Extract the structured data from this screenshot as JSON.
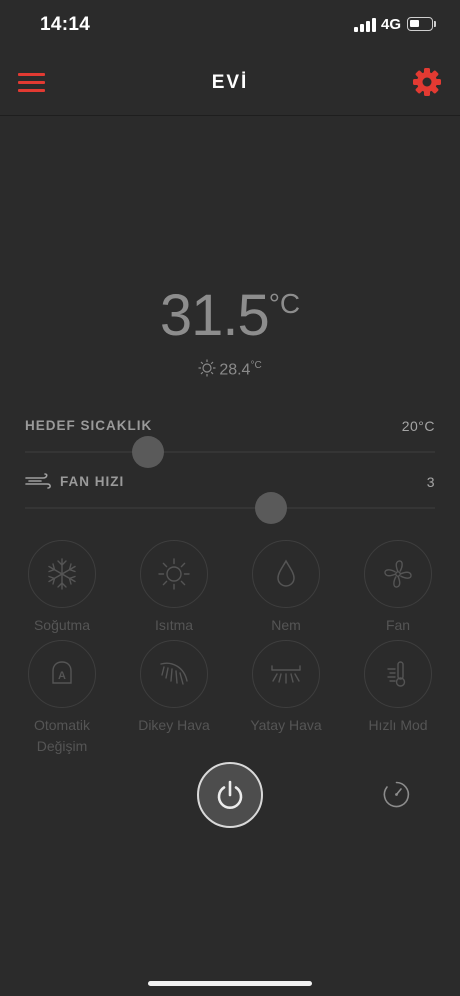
{
  "status_bar": {
    "time": "14:14",
    "network": "4G",
    "battery_level": 0.45
  },
  "header": {
    "title": "EVİ"
  },
  "temperature": {
    "value": "31.5",
    "unit": "°C",
    "outdoor_value": "28.4",
    "outdoor_unit": "°C"
  },
  "target_temp": {
    "label": "HEDEF SICAKLIK",
    "value": "20°C",
    "level": 0.3
  },
  "fan_speed": {
    "label": "FAN HIZI",
    "value": "3",
    "level": 0.6
  },
  "modes": [
    {
      "label": "Soğutma",
      "icon": "snowflake-icon"
    },
    {
      "label": "Isıtma",
      "icon": "sun-icon"
    },
    {
      "label": "Nem",
      "icon": "drop-icon"
    },
    {
      "label": "Fan",
      "icon": "fan-icon"
    },
    {
      "label": "Otomatik Değişim",
      "icon": "auto-mode-icon"
    },
    {
      "label": "Dikey Hava",
      "icon": "vertical-swing-icon"
    },
    {
      "label": "Yatay Hava",
      "icon": "horizontal-swing-icon"
    },
    {
      "label": "Hızlı Mod",
      "icon": "turbo-thermometer-icon"
    }
  ],
  "colors": {
    "accent": "#e23a32",
    "background": "#2b2b2b"
  }
}
